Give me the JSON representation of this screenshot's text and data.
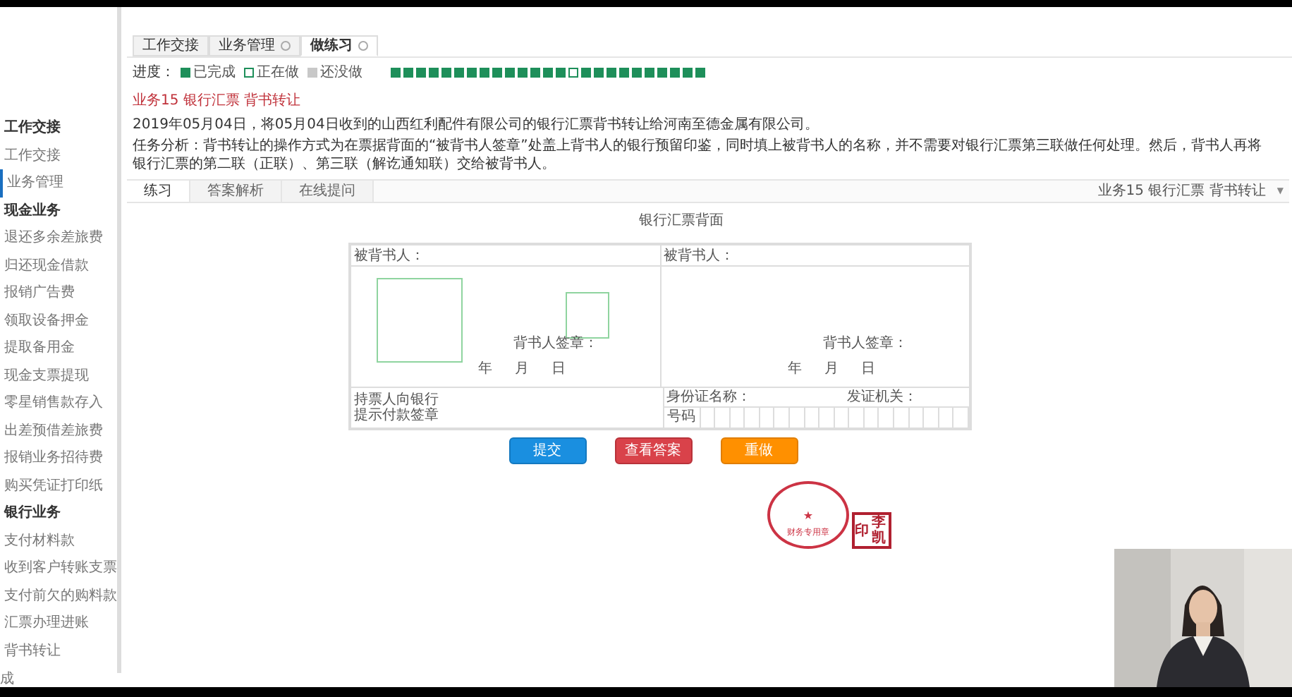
{
  "top_tabs": [
    {
      "label": "工作交接",
      "closable": false,
      "selected": false
    },
    {
      "label": "业务管理",
      "closable": true,
      "selected": false
    },
    {
      "label": "做练习",
      "closable": true,
      "selected": true
    }
  ],
  "sidebar": {
    "items": [
      {
        "kind": "header",
        "label": "工作交接",
        "selected": false
      },
      {
        "kind": "item",
        "label": "工作交接",
        "selected": false
      },
      {
        "kind": "item",
        "label": "业务管理",
        "selected": true
      },
      {
        "kind": "header",
        "label": "现金业务",
        "selected": false
      },
      {
        "kind": "item",
        "label": "退还多余差旅费",
        "selected": false
      },
      {
        "kind": "item",
        "label": "归还现金借款",
        "selected": false
      },
      {
        "kind": "item",
        "label": "报销广告费",
        "selected": false
      },
      {
        "kind": "item",
        "label": "领取设备押金",
        "selected": false
      },
      {
        "kind": "item",
        "label": "提取备用金",
        "selected": false
      },
      {
        "kind": "item",
        "label": "现金支票提现",
        "selected": false
      },
      {
        "kind": "item",
        "label": "零星销售款存入",
        "selected": false
      },
      {
        "kind": "item",
        "label": "出差预借差旅费",
        "selected": false
      },
      {
        "kind": "item",
        "label": "报销业务招待费",
        "selected": false
      },
      {
        "kind": "item",
        "label": "购买凭证打印纸",
        "selected": false
      },
      {
        "kind": "header",
        "label": "银行业务",
        "selected": false
      },
      {
        "kind": "item",
        "label": "支付材料款",
        "selected": false
      },
      {
        "kind": "item",
        "label": "收到客户转账支票",
        "selected": false
      },
      {
        "kind": "item",
        "label": "支付前欠的购料款",
        "selected": false
      },
      {
        "kind": "item",
        "label": "汇票办理进账",
        "selected": false
      },
      {
        "kind": "item",
        "label": "背书转让",
        "selected": false
      }
    ]
  },
  "progress": {
    "label": "进度：",
    "legend": [
      {
        "kind": "done",
        "label": "已完成"
      },
      {
        "kind": "doing",
        "label": "正在做"
      },
      {
        "kind": "todo",
        "label": "还没做"
      }
    ],
    "steps": [
      {
        "kind": "done"
      },
      {
        "kind": "done"
      },
      {
        "kind": "done"
      },
      {
        "kind": "done"
      },
      {
        "kind": "done"
      },
      {
        "kind": "done"
      },
      {
        "kind": "done"
      },
      {
        "kind": "done"
      },
      {
        "kind": "done"
      },
      {
        "kind": "done"
      },
      {
        "kind": "done"
      },
      {
        "kind": "done"
      },
      {
        "kind": "done"
      },
      {
        "kind": "done"
      },
      {
        "kind": "doing"
      },
      {
        "kind": "done"
      },
      {
        "kind": "done"
      },
      {
        "kind": "done"
      },
      {
        "kind": "done"
      },
      {
        "kind": "done"
      },
      {
        "kind": "done"
      },
      {
        "kind": "done"
      },
      {
        "kind": "done"
      },
      {
        "kind": "done"
      },
      {
        "kind": "done"
      }
    ]
  },
  "task": {
    "title": "业务15 银行汇票 背书转让",
    "description": "2019年05月04日，将05月04日收到的山西红利配件有限公司的银行汇票背书转让给河南至德金属有限公司。",
    "analysis": "任务分析：背书转让的操作方式为在票据背面的“被背书人签章”处盖上背书人的银行预留印鉴，同时填上被背书人的名称，并不需要对银行汇票第三联做任何处理。然后，背书人再将银行汇票的第二联（正联）、第三联（解讫通知联）交给被背书人。"
  },
  "sub_tabs": [
    {
      "label": "练习",
      "selected": true
    },
    {
      "label": "答案解析",
      "selected": false
    },
    {
      "label": "在线提问",
      "selected": false
    }
  ],
  "task_select": {
    "value": "业务15 银行汇票 背书转让",
    "caret": "▼"
  },
  "form": {
    "title": "银行汇票背面",
    "columns": [
      {
        "endorsee_label": "被背书人：",
        "seal_label": "背书人签章：",
        "date": [
          "年",
          "月",
          "日"
        ],
        "stamp_slots": true
      },
      {
        "endorsee_label": "被背书人：",
        "seal_label": "背书人签章：",
        "date": [
          "年",
          "月",
          "日"
        ],
        "stamp_slots": false
      }
    ],
    "holder_lines": [
      "持票人向银行",
      "提示付款签章"
    ],
    "id_name_label": "身份证名称：",
    "id_issuer_label": "发证机关：",
    "id_number_label": "号码"
  },
  "buttons": [
    {
      "kind": "primary",
      "label": "提交"
    },
    {
      "kind": "danger",
      "label": "查看答案"
    },
    {
      "kind": "warning",
      "label": "重做"
    }
  ],
  "stamps": {
    "star": "★",
    "round_center": "财务专用章",
    "square": [
      "印",
      "李",
      "凯"
    ]
  },
  "status_bar": "成"
}
